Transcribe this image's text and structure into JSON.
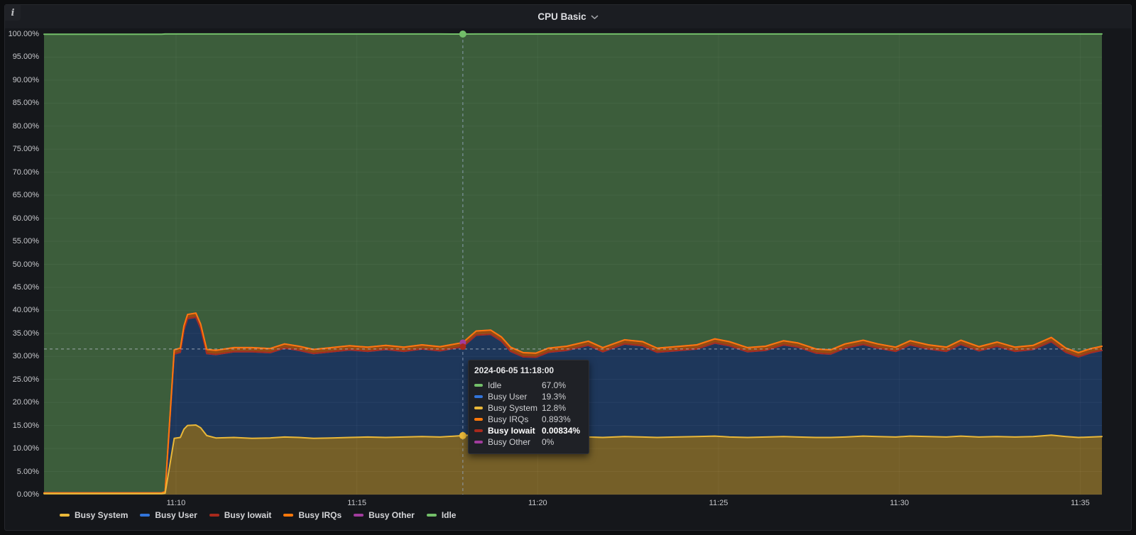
{
  "panel": {
    "title": "CPU Basic"
  },
  "icons": {
    "info_glyph": "i",
    "title_chevron": "chevron-down"
  },
  "axes": {
    "y_ticks": [
      "100.00%",
      "95.00%",
      "90.00%",
      "85.00%",
      "80.00%",
      "75.00%",
      "70.00%",
      "65.00%",
      "60.00%",
      "55.00%",
      "50.00%",
      "45.00%",
      "40.00%",
      "35.00%",
      "30.00%",
      "25.00%",
      "20.00%",
      "15.00%",
      "10.00%",
      "5.00%",
      "0.00%"
    ],
    "x_ticks": [
      "11:10",
      "11:15",
      "11:20",
      "11:25",
      "11:30",
      "11:35"
    ]
  },
  "legend": {
    "items": [
      {
        "label": "Busy System",
        "color": "#EAB839"
      },
      {
        "label": "Busy User",
        "color": "#3274D9"
      },
      {
        "label": "Busy Iowait",
        "color": "#A8291C"
      },
      {
        "label": "Busy IRQs",
        "color": "#FF780A"
      },
      {
        "label": "Busy Other",
        "color": "#A13C9D"
      },
      {
        "label": "Idle",
        "color": "#73BF69"
      }
    ]
  },
  "tooltip": {
    "timestamp": "2024-06-05 11:18:00",
    "rows": [
      {
        "label": "Idle",
        "value": "67.0%",
        "color": "#73BF69",
        "bold": false
      },
      {
        "label": "Busy User",
        "value": "19.3%",
        "color": "#3274D9",
        "bold": false
      },
      {
        "label": "Busy System",
        "value": "12.8%",
        "color": "#EAB839",
        "bold": false
      },
      {
        "label": "Busy IRQs",
        "value": "0.893%",
        "color": "#FF780A",
        "bold": false
      },
      {
        "label": "Busy Iowait",
        "value": "0.00834%",
        "color": "#A8291C",
        "bold": true
      },
      {
        "label": "Busy Other",
        "value": "0%",
        "color": "#A13C9D",
        "bold": false
      }
    ]
  },
  "chart_data": {
    "type": "area",
    "stacked": true,
    "title": "CPU Basic",
    "unit": "percent",
    "ylim": [
      0,
      100
    ],
    "y_tick_step": 5,
    "grid": true,
    "legend_position": "bottom",
    "x_axis": {
      "start_minute_after_11": 6.35,
      "end_minute_after_11": 35.6,
      "tick_minutes": [
        10,
        15,
        20,
        25,
        30,
        35
      ],
      "tick_labels": [
        "11:10",
        "11:15",
        "11:20",
        "11:25",
        "11:30",
        "11:35"
      ]
    },
    "x_minutes": [
      6.35,
      9.6,
      9.7,
      9.95,
      10.12,
      10.22,
      10.32,
      10.55,
      10.68,
      10.85,
      11.1,
      11.6,
      12.1,
      12.6,
      13.0,
      13.4,
      13.8,
      14.3,
      14.8,
      15.3,
      15.8,
      16.3,
      16.8,
      17.3,
      17.93,
      18.3,
      18.7,
      19.0,
      19.25,
      19.6,
      19.95,
      20.3,
      20.8,
      21.4,
      21.8,
      22.4,
      22.9,
      23.3,
      23.8,
      24.4,
      24.9,
      25.3,
      25.8,
      26.3,
      26.8,
      27.2,
      27.7,
      28.1,
      28.5,
      29.0,
      29.4,
      29.9,
      30.3,
      30.8,
      31.3,
      31.7,
      32.2,
      32.7,
      33.2,
      33.7,
      34.2,
      34.6,
      34.95,
      35.3,
      35.6
    ],
    "series": [
      {
        "name": "Busy System",
        "color": "#EAB839",
        "fill_opacity": 0.45,
        "values": [
          0.2,
          0.2,
          0.3,
          12.2,
          12.4,
          14.2,
          15.0,
          15.1,
          14.5,
          12.8,
          12.3,
          12.4,
          12.2,
          12.3,
          12.5,
          12.4,
          12.2,
          12.3,
          12.4,
          12.5,
          12.4,
          12.5,
          12.6,
          12.5,
          12.8,
          13.0,
          12.9,
          12.8,
          12.5,
          12.3,
          12.4,
          12.5,
          12.6,
          12.5,
          12.4,
          12.6,
          12.5,
          12.4,
          12.5,
          12.6,
          12.7,
          12.5,
          12.4,
          12.5,
          12.6,
          12.5,
          12.4,
          12.4,
          12.5,
          12.7,
          12.6,
          12.5,
          12.7,
          12.6,
          12.5,
          12.7,
          12.5,
          12.6,
          12.5,
          12.6,
          12.9,
          12.6,
          12.4,
          12.5,
          12.6
        ]
      },
      {
        "name": "Busy User",
        "color": "#3274D9",
        "fill_opacity": 0.34,
        "values": [
          0.1,
          0.1,
          0.2,
          18.3,
          18.5,
          21.5,
          23.2,
          23.4,
          21.6,
          17.8,
          18.1,
          18.6,
          18.8,
          18.5,
          19.3,
          18.9,
          18.4,
          18.7,
          19.0,
          18.6,
          19.1,
          18.6,
          19.0,
          18.7,
          19.3,
          21.6,
          21.9,
          20.5,
          18.6,
          17.6,
          17.4,
          18.4,
          18.7,
          19.9,
          18.6,
          20.1,
          19.8,
          18.5,
          18.7,
          19.0,
          20.2,
          19.8,
          18.6,
          18.8,
          19.9,
          19.5,
          18.3,
          18.1,
          19.3,
          19.9,
          19.2,
          18.6,
          19.8,
          19.0,
          18.6,
          19.9,
          18.7,
          19.6,
          18.6,
          18.9,
          20.3,
          18.3,
          17.5,
          18.3,
          18.7
        ]
      },
      {
        "name": "Busy Iowait",
        "color": "#A8291C",
        "fill_opacity": 0.5,
        "values": [
          0.01,
          0.01,
          0.01,
          0.01,
          0.01,
          0.01,
          0.01,
          0.01,
          0.01,
          0.01,
          0.01,
          0.01,
          0.01,
          0.01,
          0.01,
          0.01,
          0.01,
          0.01,
          0.01,
          0.01,
          0.01,
          0.01,
          0.01,
          0.01,
          0.00834,
          0.01,
          0.01,
          0.01,
          0.01,
          0.01,
          0.01,
          0.01,
          0.01,
          0.01,
          0.01,
          0.01,
          0.01,
          0.01,
          0.01,
          0.01,
          0.01,
          0.01,
          0.01,
          0.01,
          0.01,
          0.01,
          0.01,
          0.01,
          0.01,
          0.01,
          0.01,
          0.01,
          0.01,
          0.01,
          0.01,
          0.01,
          0.01,
          0.01,
          0.01,
          0.01,
          0.01,
          0.01,
          0.01,
          0.01,
          0.01
        ]
      },
      {
        "name": "Busy IRQs",
        "color": "#FF780A",
        "fill_opacity": 0.55,
        "values": [
          0.05,
          0.05,
          0.1,
          0.9,
          0.9,
          0.9,
          0.9,
          0.9,
          0.9,
          0.9,
          0.9,
          0.9,
          0.9,
          0.9,
          0.9,
          0.9,
          0.9,
          0.9,
          0.9,
          0.9,
          0.9,
          0.9,
          0.9,
          0.9,
          0.893,
          0.9,
          0.9,
          0.9,
          0.9,
          0.9,
          0.9,
          0.9,
          0.9,
          0.9,
          0.9,
          0.9,
          0.9,
          0.9,
          0.9,
          0.9,
          0.9,
          0.9,
          0.9,
          0.9,
          0.9,
          0.9,
          0.9,
          0.9,
          0.9,
          0.9,
          0.9,
          0.9,
          0.9,
          0.9,
          0.9,
          0.9,
          0.9,
          0.9,
          0.9,
          0.9,
          0.9,
          0.9,
          0.9,
          0.9,
          0.9
        ]
      },
      {
        "name": "Busy Other",
        "color": "#A13C9D",
        "fill_opacity": 0.5,
        "values": [
          0.01,
          0.01,
          0.01,
          0,
          0,
          0,
          0,
          0,
          0,
          0,
          0,
          0,
          0,
          0,
          0,
          0,
          0,
          0,
          0,
          0,
          0,
          0,
          0,
          0,
          0,
          0,
          0,
          0,
          0,
          0,
          0,
          0,
          0,
          0,
          0,
          0,
          0,
          0,
          0,
          0,
          0,
          0,
          0,
          0,
          0,
          0,
          0,
          0,
          0,
          0,
          0,
          0,
          0,
          0,
          0,
          0,
          0,
          0,
          0,
          0,
          0,
          0,
          0,
          0,
          0
        ]
      },
      {
        "name": "Idle",
        "color": "#73BF69",
        "fill_opacity": 0.42,
        "values": [
          99.6,
          99.6,
          99.4,
          68.6,
          68.2,
          63.4,
          60.9,
          60.6,
          63.0,
          68.5,
          68.7,
          68.1,
          68.1,
          68.3,
          67.3,
          67.8,
          68.5,
          68.1,
          67.7,
          68.0,
          67.6,
          68.0,
          67.5,
          67.9,
          67.0,
          64.5,
          64.3,
          65.8,
          68.0,
          69.2,
          69.3,
          68.2,
          67.8,
          66.7,
          68.1,
          66.4,
          66.8,
          68.2,
          67.9,
          67.5,
          66.2,
          66.8,
          68.1,
          67.8,
          66.6,
          67.1,
          68.4,
          68.6,
          67.3,
          66.5,
          67.3,
          68.0,
          66.6,
          67.5,
          68.0,
          66.5,
          67.9,
          66.9,
          68.0,
          67.6,
          65.9,
          68.2,
          69.2,
          68.3,
          67.8
        ]
      }
    ],
    "cursor": {
      "x_minute": 17.93,
      "time_label": "2024-06-05 11:18:00",
      "crosshair_percent": 31.6,
      "points": [
        {
          "series": "Idle",
          "stack_percent": 100.0,
          "color": "#73BF69",
          "r": 5
        },
        {
          "series": "Busy Other",
          "stack_percent": 33.0,
          "color": "#A13C9D",
          "r": 4.5
        },
        {
          "series": "Busy Iowait",
          "stack_percent": 32.1,
          "color": "#A8291C",
          "r": 4.5
        },
        {
          "series": "Busy System",
          "stack_percent": 12.8,
          "color": "#EAB839",
          "r": 5
        }
      ]
    }
  }
}
